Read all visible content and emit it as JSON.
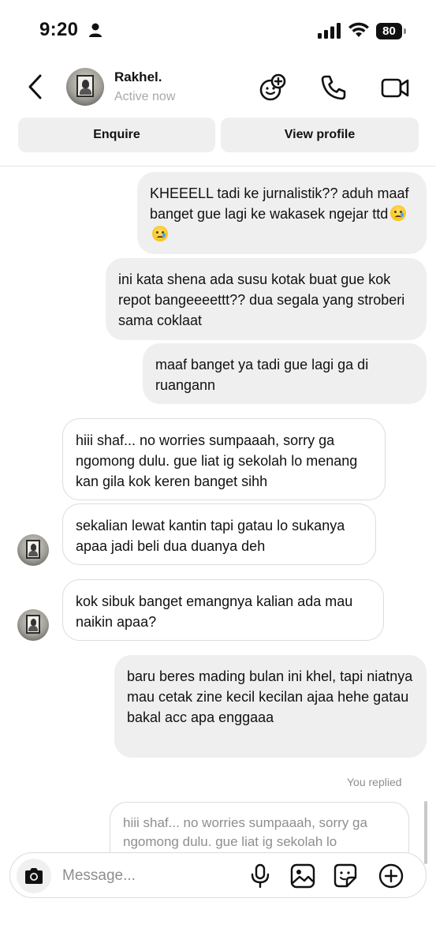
{
  "status_bar": {
    "time": "9:20",
    "battery": "80"
  },
  "header": {
    "name": "Rakhel.",
    "status": "Active now"
  },
  "actions": {
    "enquire": "Enquire",
    "view_profile": "View profile"
  },
  "messages": [
    {
      "direction": "sent",
      "text": "KHEEELL tadi ke jurnalistik?? aduh maaf banget gue lagi ke wakasek ngejar ttd",
      "emoji": "crying-face-emoji"
    },
    {
      "direction": "sent",
      "text": "ini kata shena ada susu kotak buat gue kok repot bangeeeettt?? dua segala yang stroberi sama coklaat"
    },
    {
      "direction": "sent",
      "text": "maaf banget ya tadi gue lagi ga di ruangann"
    },
    {
      "direction": "received",
      "text": "hiii shaf... no worries sumpaaah, sorry ga ngomong dulu. gue liat ig sekolah lo menang kan gila kok keren banget sihh"
    },
    {
      "direction": "received",
      "text": "sekalian lewat kantin tapi gatau lo sukanya apaa jadi beli dua duanya deh"
    },
    {
      "direction": "received",
      "text": "kok sibuk banget emangnya kalian ada mau naikin apaa?"
    },
    {
      "direction": "sent",
      "text": "baru beres mading bulan ini khel, tapi niatnya mau cetak zine kecil kecilan ajaa hehe gatau bakal acc apa enggaaa"
    }
  ],
  "reply": {
    "label": "You replied",
    "preview": "hiii shaf... no worries sumpaaah, sorry ga ngomong dulu. gue liat ig sekolah lo"
  },
  "composer": {
    "placeholder": "Message..."
  }
}
